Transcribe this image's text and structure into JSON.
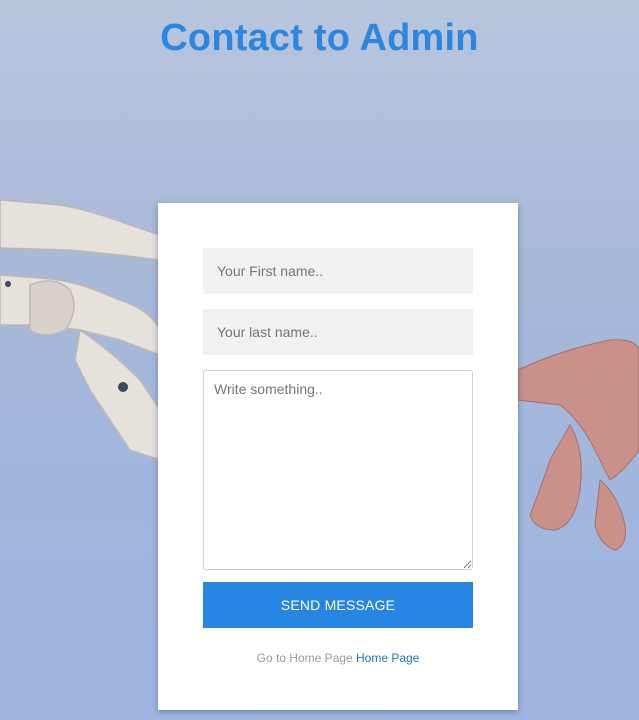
{
  "header": {
    "title": "Contact to Admin"
  },
  "form": {
    "first_name_placeholder": "Your First name..",
    "last_name_placeholder": "Your last name..",
    "message_placeholder": "Write something..",
    "submit_label": "SEND MESSAGE"
  },
  "footer": {
    "prefix_text": "Go to Home Page",
    "link_label": "Home Page"
  },
  "colors": {
    "accent": "#2686e2",
    "title": "#2b86e0",
    "link": "#2670c7"
  },
  "icons": {
    "background_left": "robot-hand-icon",
    "background_right": "human-hand-icon"
  }
}
